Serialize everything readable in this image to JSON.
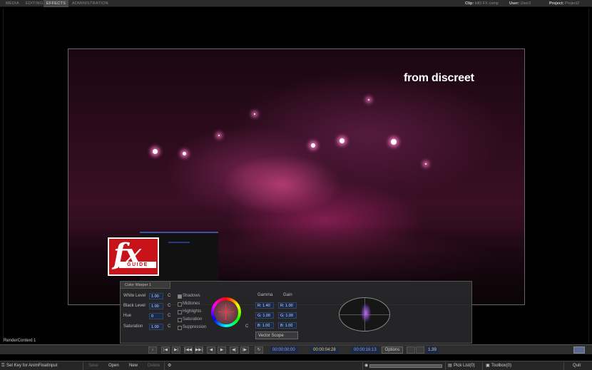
{
  "topbar": {
    "tabs": [
      {
        "label": "MEDIA",
        "active": false
      },
      {
        "label": "EDITING",
        "active": false
      },
      {
        "label": "EFFECTS",
        "active": true
      },
      {
        "label": "ADMINISTRATION",
        "active": false
      }
    ],
    "clip_label": "Clip:",
    "clip_value": "kill3 FX comp",
    "user_label": "User:",
    "user_value": "User2",
    "project_label": "Project:",
    "project_value": "Project2"
  },
  "viewer": {
    "caption": "from discreet",
    "logo_mark": "fx",
    "logo_band": "GUIDE"
  },
  "warper": {
    "title": "Color Warper 1",
    "rows": [
      {
        "label": "White Level",
        "value": "1.00",
        "c": "C"
      },
      {
        "label": "Black Level",
        "value": "1.00",
        "c": "C"
      },
      {
        "label": "Hue",
        "value": "0",
        "c": "C"
      },
      {
        "label": "Saturation",
        "value": "1.00",
        "c": "C"
      }
    ],
    "ranges": [
      {
        "label": "Shadows",
        "checked": true
      },
      {
        "label": "Midtones",
        "checked": false
      },
      {
        "label": "Highlights",
        "checked": false
      },
      {
        "label": "Saturation",
        "checked": false
      },
      {
        "label": "Suppression",
        "checked": false
      }
    ],
    "wheel_c": "C",
    "gamma_label": "Gamma",
    "gain_label": "Gain",
    "gamma": {
      "r": "R: 1.40",
      "g": "G: 1.00",
      "b": "B: 1.00"
    },
    "gain": {
      "r": "R: 1.00",
      "g": "G: 1.00",
      "b": "B: 1.00"
    },
    "scope_button": "Vector Scope"
  },
  "render_context": "RenderContext 1",
  "transport": {
    "buttons": [
      "↕",
      "|◀",
      "▶|",
      "|◀◀",
      "▶▶|",
      "◀",
      "▶",
      "◀|",
      "|▶"
    ],
    "loop_icon": "↻",
    "tc_in": "00:00:00:00",
    "tc_current": "00:00:04:28",
    "tc_out": "00:00:16:13",
    "options": "Options",
    "zoom": "1.39"
  },
  "statusbar": {
    "set_key": "Set Key for AnimFloatInput",
    "save": "Save",
    "open": "Open",
    "new": "New",
    "delete": "Delete",
    "pick_list": "Pick List(0)",
    "toolbox": "Toolbox(0)",
    "quit": "Quit"
  }
}
